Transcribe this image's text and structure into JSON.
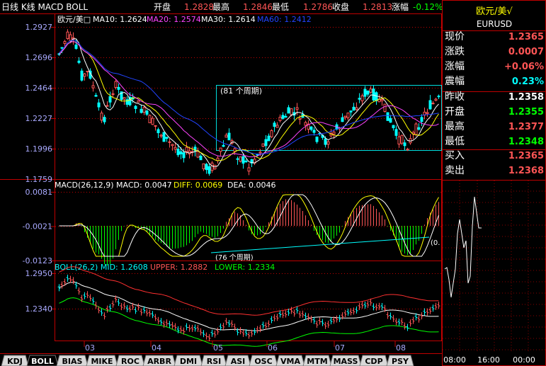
{
  "window": {
    "title": "日线 K线 MACD BOLL"
  },
  "top_quote": {
    "open_label": "开盘",
    "open_value": "1.2828",
    "high_label": "最高",
    "high_value": "1.2846",
    "low_label": "最低",
    "low_value": "1.2786",
    "close_label": "收盘",
    "close_value": "1.2813",
    "change_label": "涨幅",
    "change_value": "-0.12%"
  },
  "colors": {
    "up": "#ff5555",
    "down": "#00ffff",
    "ma10": "#ffffff",
    "ma20": "#ff44ff",
    "ma30": "#ffff00",
    "ma60": "#2244ff",
    "axis": "#c00000",
    "label": "#aaaaff",
    "green": "#00ff00",
    "yellow": "#ffff00",
    "boll_upper": "#ff3030",
    "boll_mid": "#ffffff",
    "boll_lower": "#00ff00"
  },
  "kline": {
    "symbol_label": "欧元/美□",
    "ma10_label": "MA10: 1.2624",
    "ma20_label": "MA20: 1.2574",
    "ma30_label": "MA30: 1.2614",
    "ma60_label": "MA60: 1.2412",
    "y_ticks": [
      "1.2927",
      "1.2696",
      "1.2464",
      "1.2227",
      "1.1996",
      "1.1759"
    ],
    "period_box_label": "(81 个周期)"
  },
  "macd": {
    "header": "MACD(26,12,9) MACD: 0.0047",
    "diff_label": "DIFF: 0.0069",
    "dea_label": "DEA: 0.0046",
    "y_ticks": [
      "0.0081",
      "-0.0021",
      "-0.0123"
    ],
    "trend_label": "(76 个周期)",
    "trend_end_label": "(0."
  },
  "boll": {
    "header": "BOLL(26,2) MID: 1.2608",
    "upper_label": "UPPER: 1.2882",
    "lower_label": "LOWER: 1.2334",
    "y_ticks": [
      "1.2950",
      "1.2340"
    ]
  },
  "x_axis": {
    "ticks": [
      "03",
      "04",
      "05",
      "06",
      "07",
      "08"
    ]
  },
  "indicator_tabs": [
    "KDJ",
    "BOLL",
    "BIAS",
    "MIKE",
    "ROC",
    "ARBR",
    "DMI",
    "RSI",
    "ASI",
    "OSC",
    "VMA",
    "MTM",
    "MASS",
    "CDP",
    "PSY"
  ],
  "active_tab": "BOLL",
  "right_panel": {
    "name": "欧元/美√",
    "code": "EURUSD",
    "rows": [
      {
        "label": "现价",
        "value": "1.2365",
        "color": "#ff5555"
      },
      {
        "label": "涨跌",
        "value": "0.0007",
        "color": "#ff5555"
      },
      {
        "label": "涨幅",
        "value": "+0.06%",
        "color": "#ff5555"
      },
      {
        "label": "震幅",
        "value": "0.23%",
        "color": "#00ffff"
      },
      {
        "label": "昨收",
        "value": "1.2358",
        "color": "#ffffff"
      },
      {
        "label": "开盘",
        "value": "1.2355",
        "color": "#00ff00"
      },
      {
        "label": "最高",
        "value": "1.2377",
        "color": "#ff5555"
      },
      {
        "label": "最低",
        "value": "1.2348",
        "color": "#00ff00"
      },
      {
        "label": "买入",
        "value": "1.2365",
        "color": "#ff5555"
      },
      {
        "label": "卖出",
        "value": "1.2368",
        "color": "#ff5555"
      }
    ],
    "time_ticks": [
      "08:00",
      "16:00",
      "00:00"
    ]
  }
}
